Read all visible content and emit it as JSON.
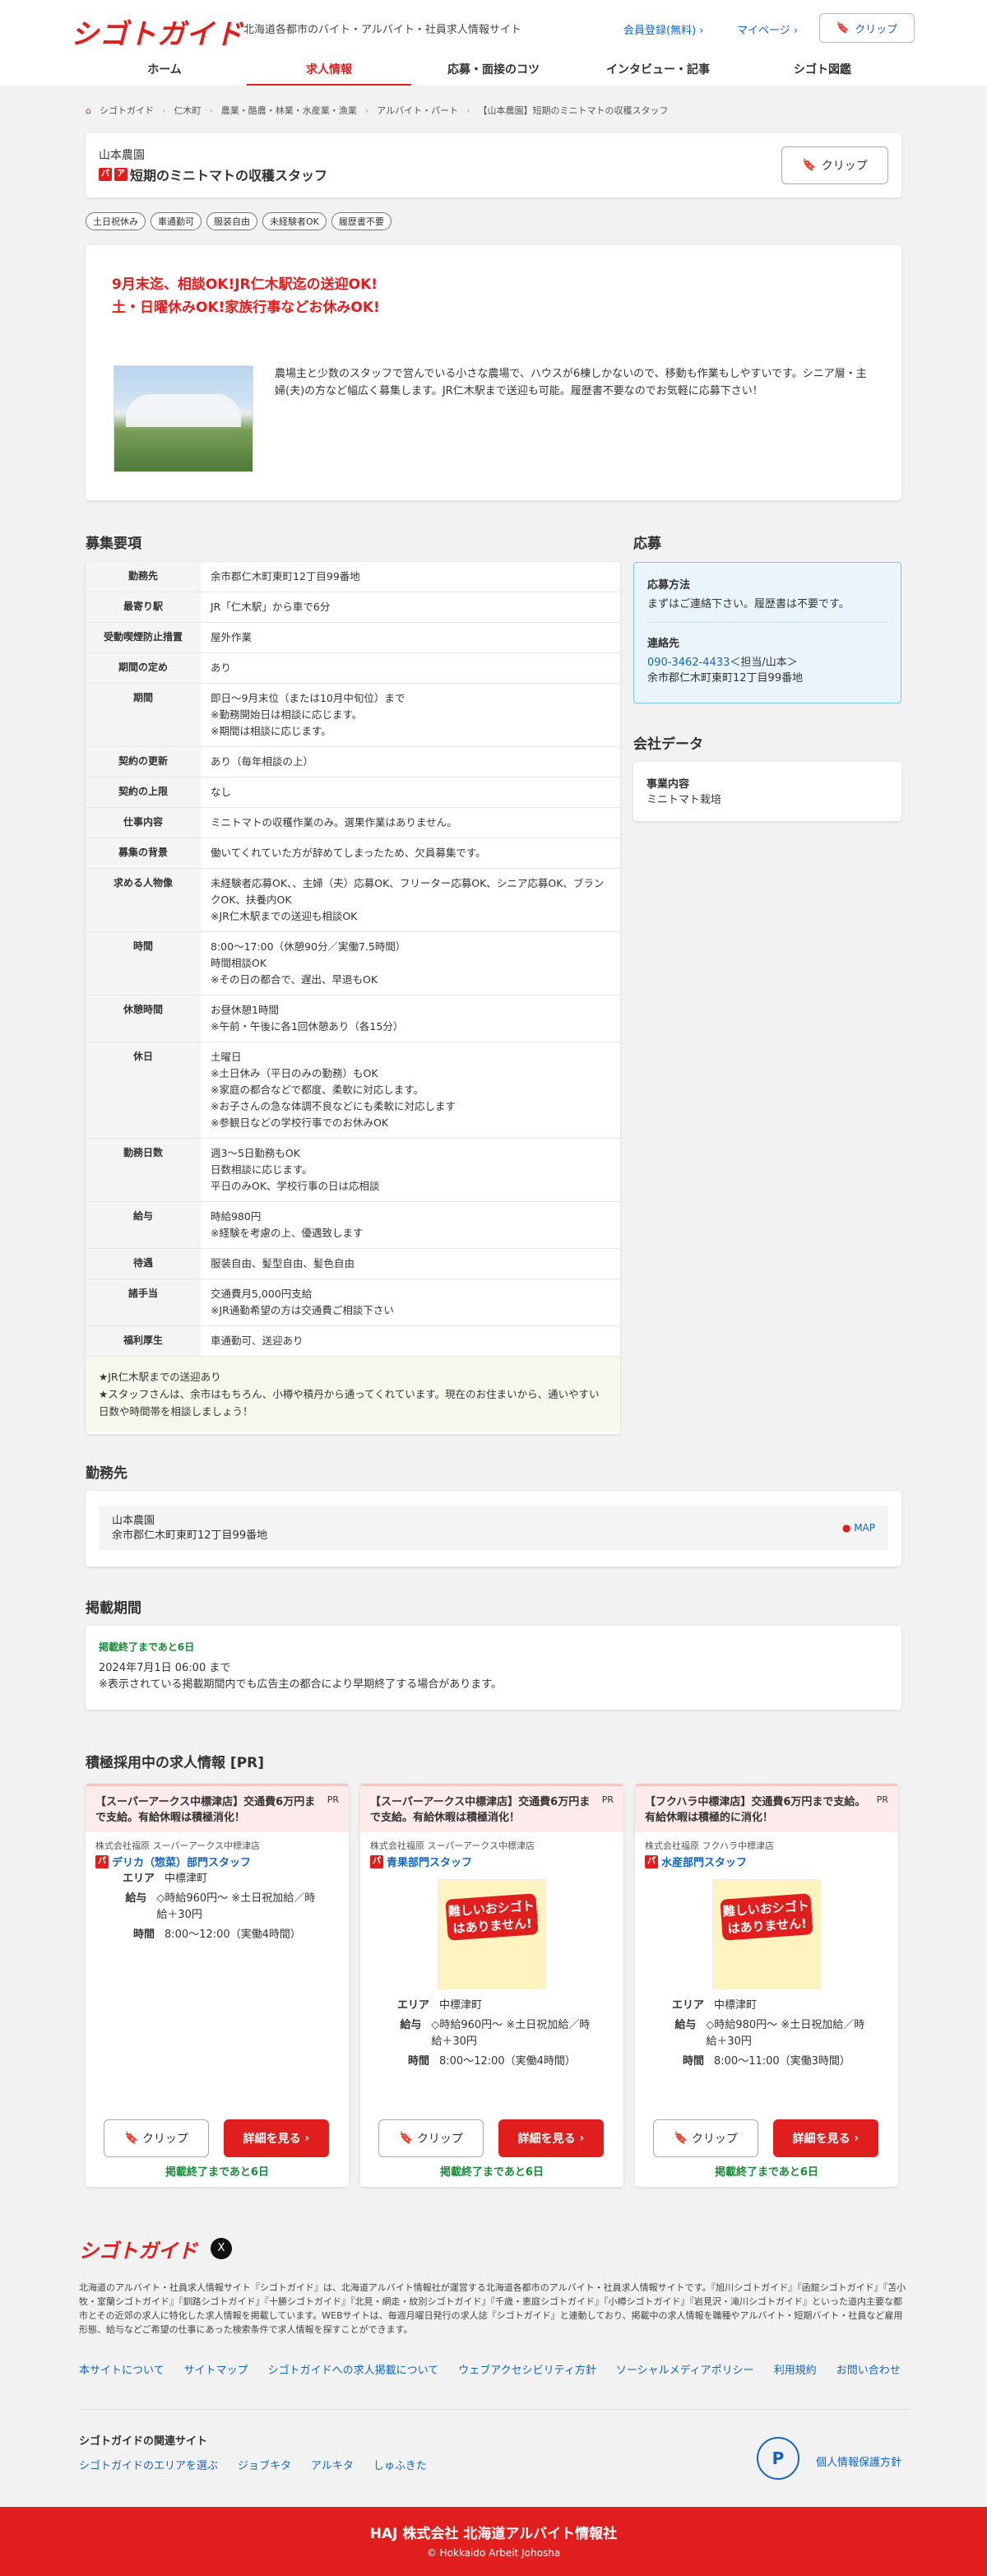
{
  "header": {
    "logo": "シゴトガイド",
    "tagline": "北海道各都市のバイト・アルバイト・社員求人情報サイト",
    "register": "会員登録(無料)",
    "mypage": "マイページ",
    "clip": "クリップ"
  },
  "nav": [
    "ホーム",
    "求人情報",
    "応募・面接のコツ",
    "インタビュー・記事",
    "シゴト図鑑"
  ],
  "breadcrumb": [
    "シゴトガイド",
    "仁木町",
    "農業・酪農・林業・水産業・漁業",
    "アルバイト・パート",
    "【山本農園】短期のミニトマトの収穫スタッフ"
  ],
  "job": {
    "company": "山本農園",
    "badge1": "パ",
    "badge2": "ア",
    "title": "短期のミニトマトの収穫スタッフ",
    "clip": "クリップ"
  },
  "tags": [
    "土日祝休み",
    "車通勤可",
    "服装自由",
    "未経験者OK",
    "履歴書不要"
  ],
  "catch": {
    "line1": "9月末迄、相談OK!JR仁木駅迄の送迎OK!",
    "line2": "土・日曜休みOK!家族行事などお休みOK!",
    "desc": "農場主と少数のスタッフで営んでいる小さな農場で、ハウスが6棟しかないので、移動も作業もしやすいです。シニア層・主婦(夫)の方など幅広く募集します。JR仁木駅まで送迎も可能。履歴書不要なのでお気軽に応募下さい！"
  },
  "sections": {
    "req": "募集要項",
    "apply": "応募",
    "company": "会社データ",
    "workplace": "勤務先",
    "period": "掲載期間",
    "pr": "積極採用中の求人情報 [PR]"
  },
  "requirements": [
    {
      "k": "勤務先",
      "v": "余市郡仁木町東町12丁目99番地"
    },
    {
      "k": "最寄り駅",
      "v": "JR「仁木駅」から車で6分"
    },
    {
      "k": "受動喫煙防止措置",
      "v": "屋外作業"
    },
    {
      "k": "期間の定め",
      "v": "あり"
    },
    {
      "k": "期間",
      "v": "即日～9月末位（または10月中旬位）まで\n※勤務開始日は相談に応じます。\n※期間は相談に応じます。"
    },
    {
      "k": "契約の更新",
      "v": "あり（毎年相談の上）"
    },
    {
      "k": "契約の上限",
      "v": "なし"
    },
    {
      "k": "仕事内容",
      "v": "ミニトマトの収穫作業のみ。選果作業はありません。"
    },
    {
      "k": "募集の背景",
      "v": "働いてくれていた方が辞めてしまったため、欠員募集です。"
    },
    {
      "k": "求める人物像",
      "v": "未経験者応募OK、、主婦（夫）応募OK、フリーター応募OK、シニア応募OK、ブランクOK、扶養内OK\n※JR仁木駅までの送迎も相談OK"
    },
    {
      "k": "時間",
      "v": "8:00～17:00（休憩90分／実働7.5時間）\n時間相談OK\n※その日の都合で、遅出、早退もOK"
    },
    {
      "k": "休憩時間",
      "v": "お昼休憩1時間\n※午前・午後に各1回休憩あり（各15分）"
    },
    {
      "k": "休日",
      "v": "土曜日\n※土日休み（平日のみの勤務）もOK\n※家庭の都合などで都度、柔軟に対応します。\n※お子さんの急な体調不良などにも柔軟に対応します\n※参観日などの学校行事でのお休みOK"
    },
    {
      "k": "勤務日数",
      "v": "週3～5日勤務もOK\n日数相談に応じます。\n平日のみOK、学校行事の日は応相談"
    },
    {
      "k": "給与",
      "v": "時給980円\n※経験を考慮の上、優遇致します"
    },
    {
      "k": "待遇",
      "v": "服装自由、髪型自由、髪色自由"
    },
    {
      "k": "諸手当",
      "v": "交通費月5,000円支給\n※JR通勤希望の方は交通費ご相談下さい"
    },
    {
      "k": "福利厚生",
      "v": "車通勤可、送迎あり"
    }
  ],
  "req_note": "★JR仁木駅までの送迎あり\n★スタッフさんは、余市はもちろん、小樽や積丹から通ってくれています。現在のお住まいから、通いやすい日数や時間帯を相談しましょう！",
  "apply": {
    "method_label": "応募方法",
    "method": "まずはご連絡下さい。履歴書は不要です。",
    "contact_label": "連絡先",
    "tel": "090-3462-4433",
    "person": "＜担当/山本＞",
    "address": "余市郡仁木町東町12丁目99番地"
  },
  "company_data": {
    "label": "事業内容",
    "value": "ミニトマト栽培"
  },
  "workplace": {
    "name": "山本農園",
    "address": "余市郡仁木町東町12丁目99番地",
    "map": "MAP"
  },
  "period": {
    "remain": "掲載終了まであと6日",
    "date": "2024年7月1日 06:00 まで",
    "note": "※表示されている掲載期間内でも広告主の都合により早期終了する場合があります。"
  },
  "pr_jobs": [
    {
      "head": "【スーパーアークス中標津店】交通費6万円まで支給。有給休暇は積極消化！",
      "pr": "PR",
      "company": "株式会社福原 スーパーアークス中標津店",
      "badge": "パ",
      "title": "デリカ（惣菜）部門スタッフ",
      "area": "中標津町",
      "wage": "◇時給960円～ ※土日祝加給／時給＋30円",
      "time": "8:00～12:00（実働4時間）",
      "img": "",
      "clip": "クリップ",
      "detail": "詳細を見る",
      "end": "掲載終了まであと6日"
    },
    {
      "head": "【スーパーアークス中標津店】交通費6万円まで支給。有給休暇は積極消化！",
      "pr": "PR",
      "company": "株式会社福原 スーパーアークス中標津店",
      "badge": "パ",
      "title": "青果部門スタッフ",
      "area": "中標津町",
      "wage": "◇時給960円～ ※土日祝加給／時給＋30円",
      "time": "8:00～12:00（実働4時間）",
      "img": "難しいおシゴトはありません!",
      "clip": "クリップ",
      "detail": "詳細を見る",
      "end": "掲載終了まであと6日"
    },
    {
      "head": "【フクハラ中標津店】交通費6万円まで支給。有給休暇は積極的に消化！",
      "pr": "PR",
      "company": "株式会社福原 フクハラ中標津店",
      "badge": "パ",
      "title": "水産部門スタッフ",
      "area": "中標津町",
      "wage": "◇時給980円～ ※土日祝加給／時給＋30円",
      "time": "8:00～11:00（実働3時間）",
      "img": "難しいおシゴトはありません!",
      "clip": "クリップ",
      "detail": "詳細を見る",
      "end": "掲載終了まであと6日"
    }
  ],
  "labels": {
    "area": "エリア",
    "wage": "給与",
    "time": "時間"
  },
  "footer": {
    "logo": "シゴトガイド",
    "x": "X",
    "desc": "北海道のアルバイト・社員求人情報サイト『シゴトガイド』は、北海道アルバイト情報社が運営する北海道各都市のアルバイト・社員求人情報サイトです。『旭川シゴトガイド』『函館シゴトガイド』『苫小牧・室蘭シゴトガイド』『釧路シゴトガイド』『十勝シゴトガイド』『北見・網走・紋別シゴトガイド』『千歳・恵庭シゴトガイド』『小樽シゴトガイド』『岩見沢・滝川シゴトガイド』といった道内主要な都市とその近郊の求人に特化した求人情報を掲載しています。WEBサイトは、毎週月曜日発行の求人誌『シゴトガイド』と連動しており、掲載中の求人情報を職種やアルバイト・短期バイト・社員など雇用形態、給与などご希望の仕事にあった検索条件で求人情報を探すことができます。",
    "links": [
      "本サイトについて",
      "サイトマップ",
      "シゴトガイドへの求人掲載について",
      "ウェブアクセシビリティ方針",
      "ソーシャルメディアポリシー",
      "利用規約",
      "お問い合わせ"
    ],
    "related_title": "シゴトガイドの関連サイト",
    "related": [
      "シゴトガイドのエリアを選ぶ",
      "ジョブキタ",
      "アルキタ",
      "しゅふきた"
    ],
    "privacy": "個人情報保護方針",
    "pmark": "P"
  },
  "bottom": {
    "name": "HAJ 株式会社 北海道アルバイト情報社",
    "copy": "© Hokkaido Arbeit Johosha"
  }
}
